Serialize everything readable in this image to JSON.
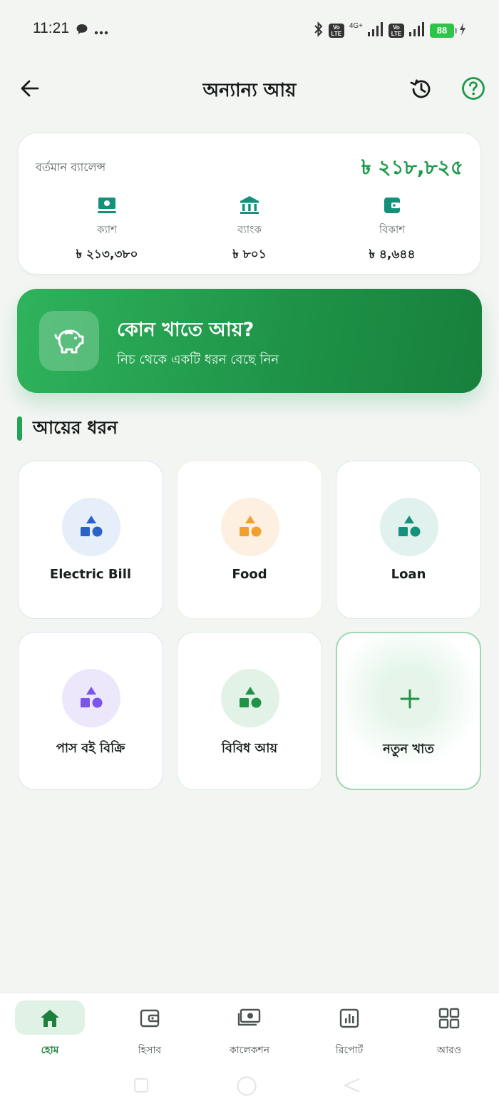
{
  "status_bar": {
    "time": "11:21",
    "network_label": "4G+",
    "volte_label": "Vo\nLTE",
    "battery": "88"
  },
  "header": {
    "title": "অন্যান্য আয়",
    "icons": [
      "back-arrow-icon",
      "history-icon",
      "help-icon"
    ]
  },
  "balance": {
    "label": "বর্তমান ব্যালেন্স",
    "total": "৳ ২১৮,৮২৫",
    "accounts": [
      {
        "label": "ক্যাশ",
        "value": "৳ ২১৩,৩৮০",
        "icon": "cash-icon"
      },
      {
        "label": "ব্যাংক",
        "value": "৳ ৮০১",
        "icon": "bank-icon"
      },
      {
        "label": "বিকাশ",
        "value": "৳ ৪,৬৪৪",
        "icon": "wallet-icon"
      }
    ],
    "accent_color": "#1e9a4a"
  },
  "banner": {
    "title": "কোন খাতে আয়?",
    "subtitle": "নিচ থেকে একটি ধরন বেছে নিন",
    "icon": "piggy-bank-icon"
  },
  "section": {
    "title": "আয়ের ধরন"
  },
  "categories": [
    {
      "name": "Electric Bill",
      "color": "#2b62c8",
      "bg": "#e5eef9",
      "border": "#dce3f0"
    },
    {
      "name": "Food",
      "color": "#f2a02c",
      "bg": "#fdf0e0",
      "border": "#f7eede"
    },
    {
      "name": "Loan",
      "color": "#15907a",
      "bg": "#e1f1ee",
      "border": "#d9e9e6"
    },
    {
      "name": "পাস বই বিক্রি",
      "color": "#7b55ea",
      "bg": "#ece7fb",
      "border": "#e2e0f3"
    },
    {
      "name": "বিবিধ আয়",
      "color": "#1f9448",
      "bg": "#e2f2e7",
      "border": "#d9ebdf"
    }
  ],
  "new_category": {
    "label": "নতুন খাত",
    "icon": "plus-icon",
    "color": "#1f9448"
  },
  "bottom_nav": {
    "items": [
      {
        "label": "হোম",
        "icon": "home-icon",
        "active": true
      },
      {
        "label": "হিসাব",
        "icon": "wallet-icon"
      },
      {
        "label": "কালেকশন",
        "icon": "collection-icon"
      },
      {
        "label": "রিপোর্ট",
        "icon": "report-icon"
      },
      {
        "label": "আরও",
        "icon": "grid-icon"
      }
    ]
  }
}
